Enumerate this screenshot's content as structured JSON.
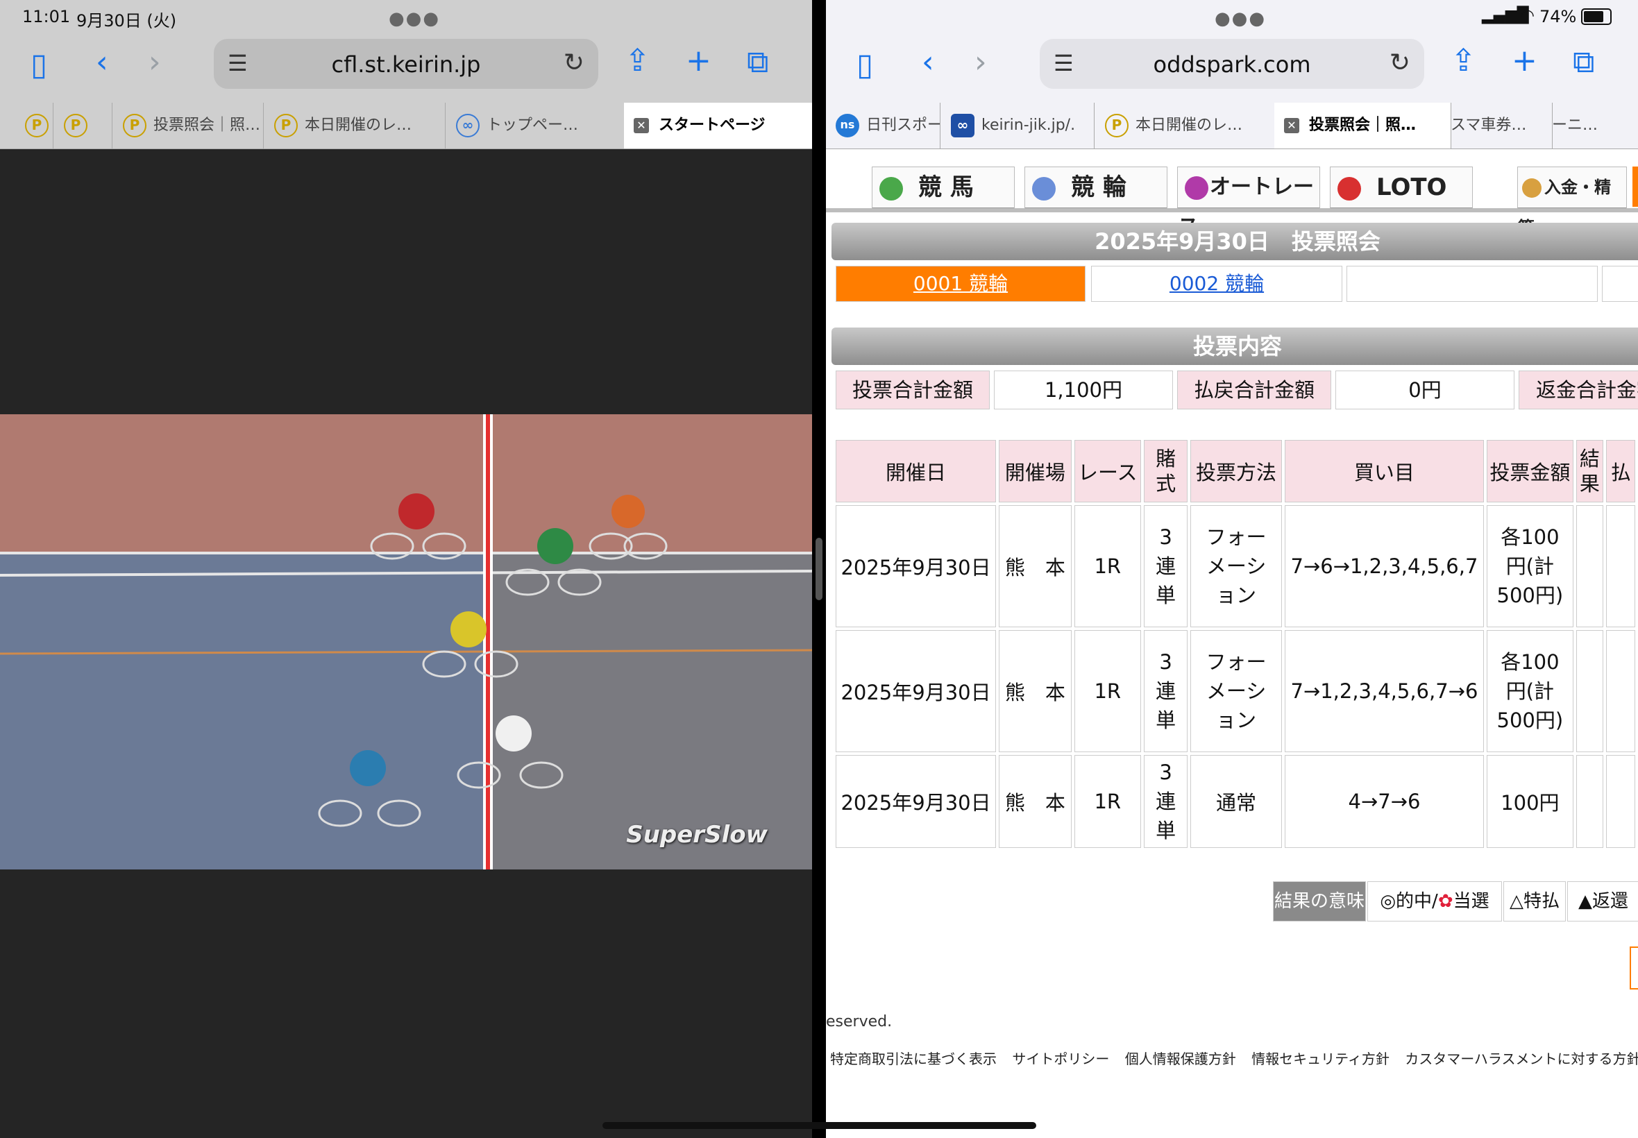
{
  "left_window": {
    "status": {
      "time": "11:01",
      "date": "9月30日 (火)"
    },
    "url": "cfl.st.keirin.jp",
    "tabs": [
      {
        "label": ""
      },
      {
        "label": "投票照会｜照…"
      },
      {
        "label": "本日開催のレ…"
      },
      {
        "label": "トップペー…"
      },
      {
        "label": "スタートページ"
      }
    ],
    "video": {
      "overlay_text": "SuperSlow"
    }
  },
  "right_window": {
    "status": {
      "signal": "signal-icon",
      "wifi": "wifi-icon",
      "battery_text": "74%"
    },
    "url": "oddspark.com",
    "tabs": [
      {
        "label": "日刊スポー"
      },
      {
        "label": "keirin-jik.jp/."
      },
      {
        "label": "本日開催のレ…"
      },
      {
        "label": "投票照会｜照…"
      },
      {
        "label": "スマ車券…"
      },
      {
        "label": "ーニ…"
      }
    ],
    "site_nav": {
      "keiba": "競 馬",
      "keirin": "競 輪",
      "autorace": "オートレース",
      "loto": "LOTO",
      "deposit": "入金・精算"
    },
    "page_title": "2025年9月30日　投票照会",
    "accounts": [
      {
        "label": "0001 競輪"
      },
      {
        "label": "0002 競輪"
      },
      {
        "label": ""
      },
      {
        "label": ""
      }
    ],
    "content_header": "投票内容",
    "summary": {
      "bet_total_label": "投票合計金額",
      "bet_total_value": "1,100円",
      "payout_total_label": "払戻合計金額",
      "payout_total_value": "0円",
      "refund_total_label": "返金合計金額"
    },
    "table": {
      "headers": [
        "開催日",
        "開催場",
        "レース",
        "賭式",
        "投票方法",
        "買い目",
        "投票金額",
        "結果",
        "払"
      ],
      "rows": [
        {
          "date": "2025年9月30日",
          "venue": "熊　本",
          "race": "1R",
          "type": "3連単",
          "method": "フォーメーション",
          "combo": "7→6→1,2,3,4,5,6,7",
          "amount": "各100円(計500円)",
          "result": "",
          "payout": ""
        },
        {
          "date": "2025年9月30日",
          "venue": "熊　本",
          "race": "1R",
          "type": "3連単",
          "method": "フォーメーション",
          "combo": "7→1,2,3,4,5,6,7→6",
          "amount": "各100円(計500円)",
          "result": "",
          "payout": ""
        },
        {
          "date": "2025年9月30日",
          "venue": "熊　本",
          "race": "1R",
          "type": "3連単",
          "method": "通常",
          "combo": "4→7→6",
          "amount": "100円",
          "result": "",
          "payout": ""
        }
      ]
    },
    "legend": {
      "head": "結果の意味",
      "hit": "◎的中/",
      "win": "当選",
      "special": "△特払",
      "refund": "▲返還"
    },
    "footer": {
      "copyright": "eserved.",
      "links": [
        "特定商取引法に基づく表示",
        "サイトポリシー",
        "個人情報保護方針",
        "情報セキュリティ方針",
        "カスタマーハラスメントに対する方針"
      ]
    }
  },
  "colors": {
    "accent": "#1a73e8",
    "orange": "#ff7d00",
    "pink": "#f8dfe5",
    "track_blue": "#6b7a96",
    "track_red": "#b07a70"
  }
}
